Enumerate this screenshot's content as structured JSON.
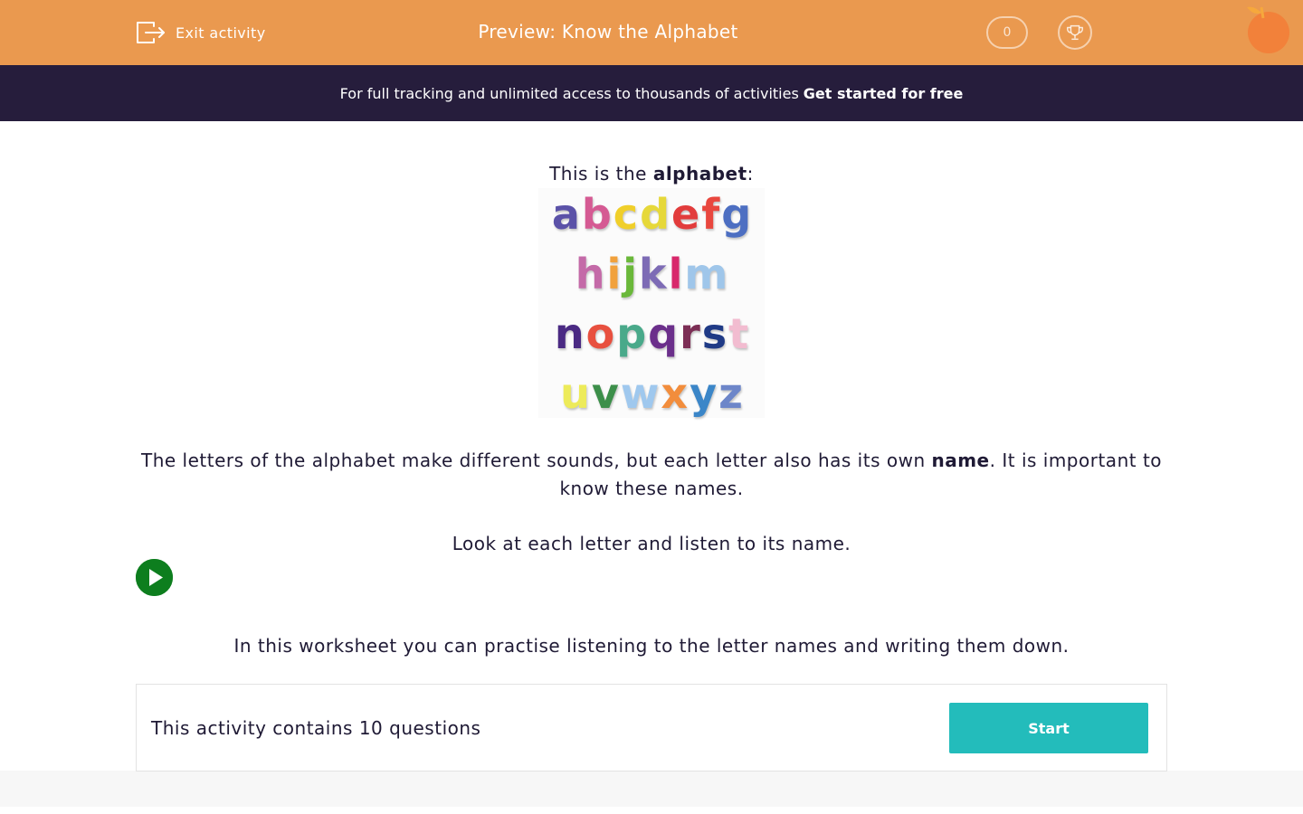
{
  "topbar": {
    "exit_label": "Exit activity",
    "title": "Preview: Know the Alphabet",
    "score": "0",
    "bg_color": "#ea994f"
  },
  "banner": {
    "text": "For full tracking and unlimited access to thousands of activities",
    "cta": "Get started for free",
    "bg_color": "#261d3c"
  },
  "intro": {
    "prefix": "This is the ",
    "bold": "alphabet",
    "suffix": ":"
  },
  "alphabet_image": {
    "rows": [
      [
        "a",
        "b",
        "c",
        "d",
        "e",
        "f",
        "g"
      ],
      [
        "h",
        "i",
        "j",
        "k",
        "l",
        "m"
      ],
      [
        "n",
        "o",
        "p",
        "q",
        "r",
        "s",
        "t"
      ],
      [
        "u",
        "v",
        "w",
        "x",
        "y",
        "z"
      ]
    ],
    "colors": [
      [
        "#5b52a8",
        "#d55a93",
        "#f0cf2a",
        "#e6d83a",
        "#e23c3c",
        "#e9473e",
        "#4d6fc2"
      ],
      [
        "#c46aa8",
        "#f1a13c",
        "#6ab83a",
        "#7d6bb5",
        "#d8286b",
        "#9fc6ea"
      ],
      [
        "#4a2a83",
        "#e8503f",
        "#49a98a",
        "#6b2f8b",
        "#7c2e55",
        "#1f3a86",
        "#f2bcd0"
      ],
      [
        "#edeb5a",
        "#3c8f4a",
        "#9fc8ee",
        "#f28d3c",
        "#3b86c8",
        "#6d86c9"
      ]
    ]
  },
  "letters_paragraph": {
    "part1": "The letters of the alphabet make different sounds, but each letter also has its own ",
    "bold": "name",
    "part2": ". It is important to know these names."
  },
  "look_text": "Look at each letter and listen to its name.",
  "play_icon": "play-circle-icon",
  "worksheet_text": "In this worksheet you can practise listening to the letter names and writing them down.",
  "activity": {
    "text": "This activity contains 10 questions",
    "start_label": "Start",
    "accent_color": "#23bcbb"
  }
}
